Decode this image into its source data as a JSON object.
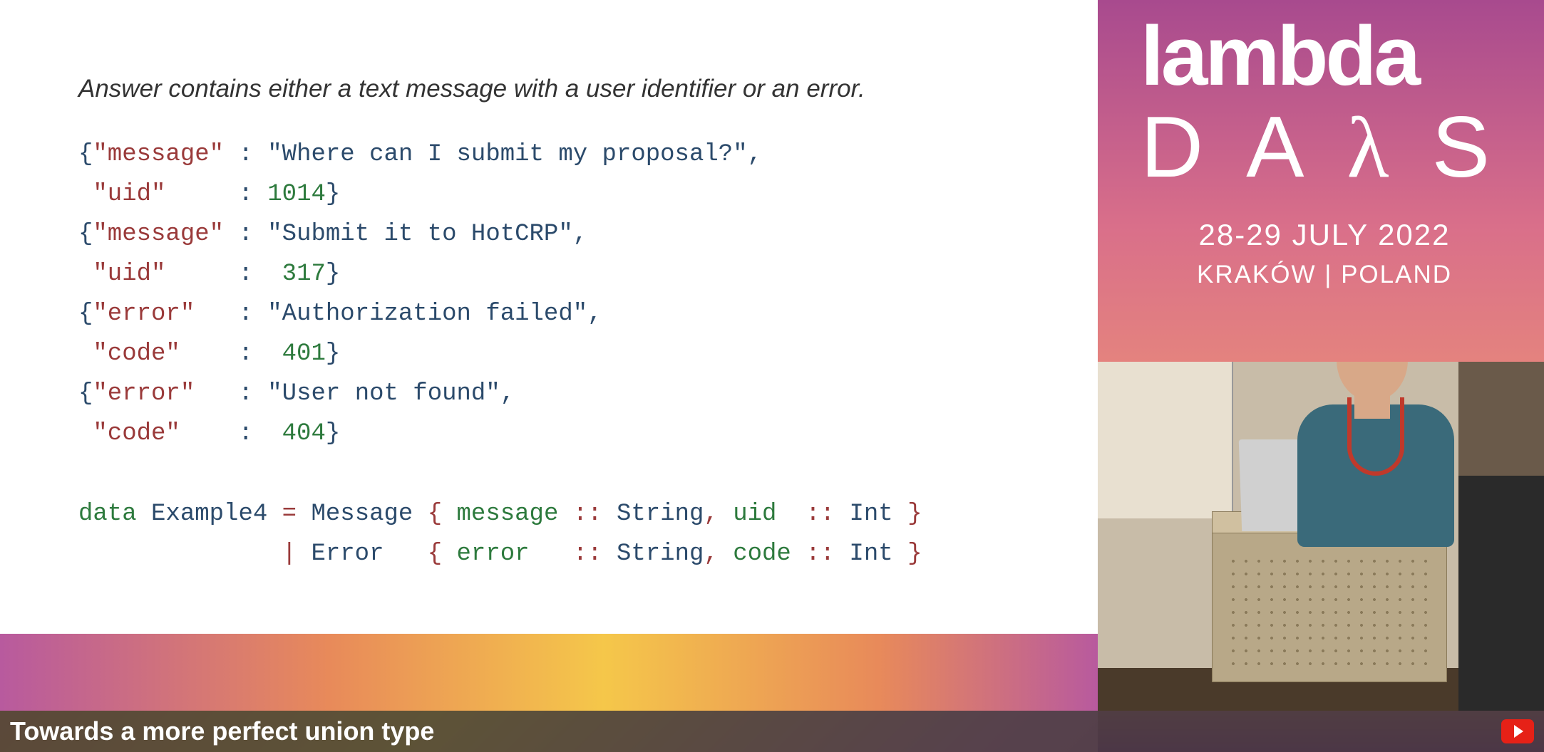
{
  "slide": {
    "description": "Answer contains either a text message with a user identifier or an error.",
    "json_examples": [
      {
        "message": "Where can I submit my proposal?",
        "uid": 1014
      },
      {
        "message": "Submit it to HotCRP",
        "uid": 317
      },
      {
        "error": "Authorization failed",
        "code": 401
      },
      {
        "error": "User not found",
        "code": 404
      }
    ],
    "haskell_line1_kw": "data",
    "haskell_line1_rest": " Example4 = Message { message :: String, uid  :: Int }",
    "haskell_line2": "              | Error   { error   :: String, code :: Int }"
  },
  "event": {
    "logo_line1": "lambda",
    "logo_line2_chars": [
      "D",
      "A",
      "λ",
      "S"
    ],
    "date": "28-29 JULY 2022",
    "location": "KRAKÓW | POLAND"
  },
  "footer": {
    "talk_title": "Towards a more perfect union type"
  }
}
